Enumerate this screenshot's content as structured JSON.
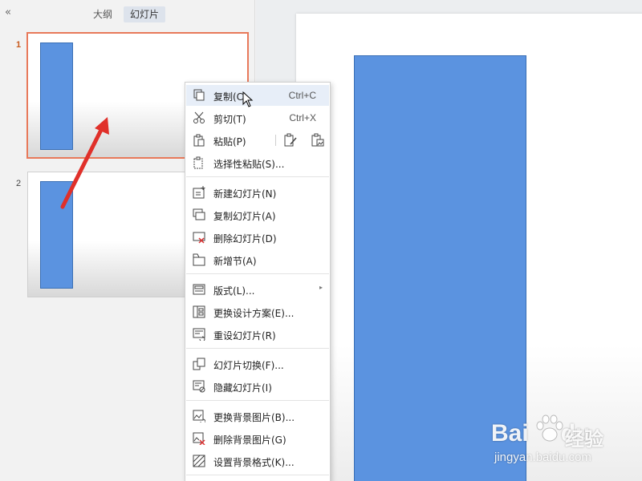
{
  "left_pane": {
    "collapse_glyph": "«",
    "tabs": [
      {
        "label": "大纲",
        "active": false
      },
      {
        "label": "幻灯片",
        "active": true
      }
    ],
    "slides": [
      {
        "number": "1",
        "active": true
      },
      {
        "number": "2",
        "active": false
      }
    ]
  },
  "context_menu": {
    "items": [
      {
        "label": "复制(C)",
        "shortcut": "Ctrl+C",
        "icon": "copy-icon"
      },
      {
        "label": "剪切(T)",
        "shortcut": "Ctrl+X",
        "icon": "cut-icon"
      },
      {
        "label": "粘贴(P)",
        "shortcut": "",
        "icon": "paste-icon"
      },
      {
        "label": "选择性粘贴(S)...",
        "shortcut": "",
        "icon": "paste-special-icon"
      },
      {
        "label": "新建幻灯片(N)",
        "shortcut": "",
        "icon": "new-slide-icon"
      },
      {
        "label": "复制幻灯片(A)",
        "shortcut": "",
        "icon": "duplicate-slide-icon"
      },
      {
        "label": "删除幻灯片(D)",
        "shortcut": "",
        "icon": "delete-slide-icon"
      },
      {
        "label": "新增节(A)",
        "shortcut": "",
        "icon": "add-section-icon"
      },
      {
        "label": "版式(L)...",
        "shortcut": "",
        "icon": "layout-icon",
        "submenu": true
      },
      {
        "label": "更换设计方案(E)...",
        "shortcut": "",
        "icon": "design-icon"
      },
      {
        "label": "重设幻灯片(R)",
        "shortcut": "",
        "icon": "reset-slide-icon"
      },
      {
        "label": "幻灯片切换(F)...",
        "shortcut": "",
        "icon": "transition-icon"
      },
      {
        "label": "隐藏幻灯片(I)",
        "shortcut": "",
        "icon": "hide-slide-icon"
      },
      {
        "label": "更换背景图片(B)...",
        "shortcut": "",
        "icon": "change-bg-icon"
      },
      {
        "label": "删除背景图片(G)",
        "shortcut": "",
        "icon": "delete-bg-icon"
      },
      {
        "label": "设置背景格式(K)...",
        "shortcut": "",
        "icon": "bg-format-icon"
      }
    ],
    "submenu_arrow": "▸"
  },
  "watermark": {
    "brand_left": "Bai",
    "brand_right": "du",
    "brand_cn": "经验",
    "url": "jingyan.baidu.com"
  },
  "colors": {
    "slide_shape": "#5b93e0",
    "active_thumb_border": "#e8795a",
    "annotation_arrow": "#e0302a",
    "menu_hover": "#e7eef8"
  }
}
